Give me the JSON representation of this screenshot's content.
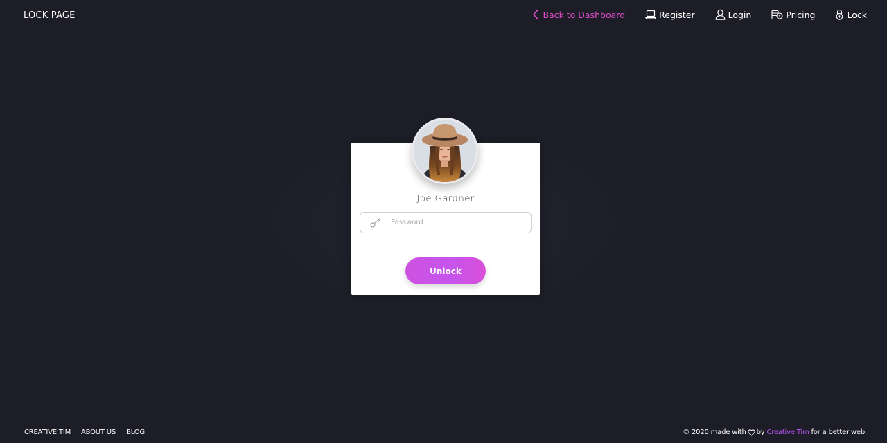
{
  "navbar": {
    "brand": "LOCK PAGE",
    "back_label": "Back to Dashboard",
    "items": [
      {
        "label": "Register",
        "icon": "laptop-icon"
      },
      {
        "label": "Login",
        "icon": "user-icon"
      },
      {
        "label": "Pricing",
        "icon": "coins-icon"
      },
      {
        "label": "Lock",
        "icon": "lock-icon"
      }
    ]
  },
  "lock_card": {
    "user_name": "Joe Gardner",
    "password_placeholder": "Password",
    "password_value": "",
    "unlock_label": "Unlock"
  },
  "footer": {
    "links": [
      "CREATIVE TIM",
      "ABOUT US",
      "BLOG"
    ],
    "copyright_prefix": "© 2020 made with",
    "copyright_by": "by",
    "copyright_brand": "Creative Tim",
    "copyright_suffix": "for a better web."
  },
  "colors": {
    "background": "#1e1e27",
    "accent": "#e14eca",
    "primary_gradient_start": "#cd52e0",
    "primary_gradient_end": "#d84fd8",
    "brand_link": "#ba54f5"
  }
}
